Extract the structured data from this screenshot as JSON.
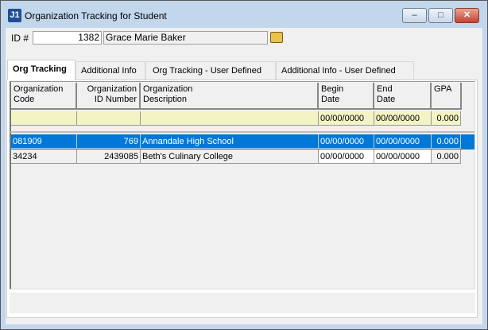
{
  "window": {
    "title": "Organization Tracking for Student",
    "icon_label": "J1"
  },
  "student": {
    "id_label": "ID #",
    "id": "1382",
    "name": "Grace Marie Baker"
  },
  "tabs": [
    {
      "label": "Org Tracking"
    },
    {
      "label": "Additional Info"
    },
    {
      "label": "Org Tracking - User Defined"
    },
    {
      "label": "Additional Info - User Defined"
    }
  ],
  "columns": [
    {
      "l1": "Organization",
      "l2": "Code"
    },
    {
      "l1": "Organization",
      "l2": "ID Number"
    },
    {
      "l1": "Organization",
      "l2": "Description"
    },
    {
      "l1": "Begin",
      "l2": "Date"
    },
    {
      "l1": "End",
      "l2": "Date"
    },
    {
      "l1": "GPA",
      "l2": ""
    }
  ],
  "filter_row": {
    "begin": "00/00/0000",
    "end": "00/00/0000",
    "gpa": "0.000"
  },
  "rows": [
    {
      "code": "081909",
      "id": "769",
      "desc": "Annandale High School",
      "begin": "00/00/0000",
      "end": "00/00/0000",
      "gpa": "0.000",
      "selected": true
    },
    {
      "code": "34234",
      "id": "2439085",
      "desc": "Beth's Culinary College",
      "begin": "00/00/0000",
      "end": "00/00/0000",
      "gpa": "0.000",
      "selected": false
    }
  ]
}
